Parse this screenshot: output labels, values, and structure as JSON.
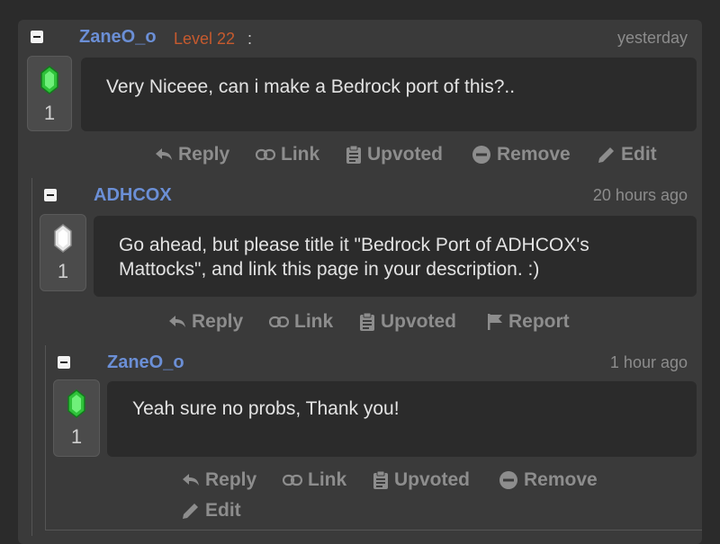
{
  "comments": [
    {
      "username": "ZaneO_o",
      "level": "Level 22",
      "separator": ":",
      "time": "yesterday",
      "votes": "1",
      "vote_icon": "emerald-icon",
      "text": "Very Niceee, can i make a Bedrock port of this?..",
      "actions": [
        "Reply",
        "Link",
        "Upvoted",
        "Remove",
        "Edit"
      ]
    },
    {
      "username": "ADHCOX",
      "time": "20 hours ago",
      "votes": "1",
      "vote_icon": "iron-gem-icon",
      "text": "Go ahead, but please title it \"Bedrock Port of ADHCOX's Mattocks\", and link this page in your description. :)",
      "actions": [
        "Reply",
        "Link",
        "Upvoted",
        "Report"
      ]
    },
    {
      "username": "ZaneO_o",
      "time": "1 hour ago",
      "votes": "1",
      "vote_icon": "emerald-icon",
      "text": "Yeah sure no probs, Thank you!",
      "actions": [
        "Reply",
        "Link",
        "Upvoted",
        "Remove",
        "Edit"
      ]
    }
  ],
  "colors": {
    "username": "#6b8fd6",
    "level": "#c65a2e",
    "emerald": "#2fc23a",
    "iron": "#e6e6e6"
  }
}
